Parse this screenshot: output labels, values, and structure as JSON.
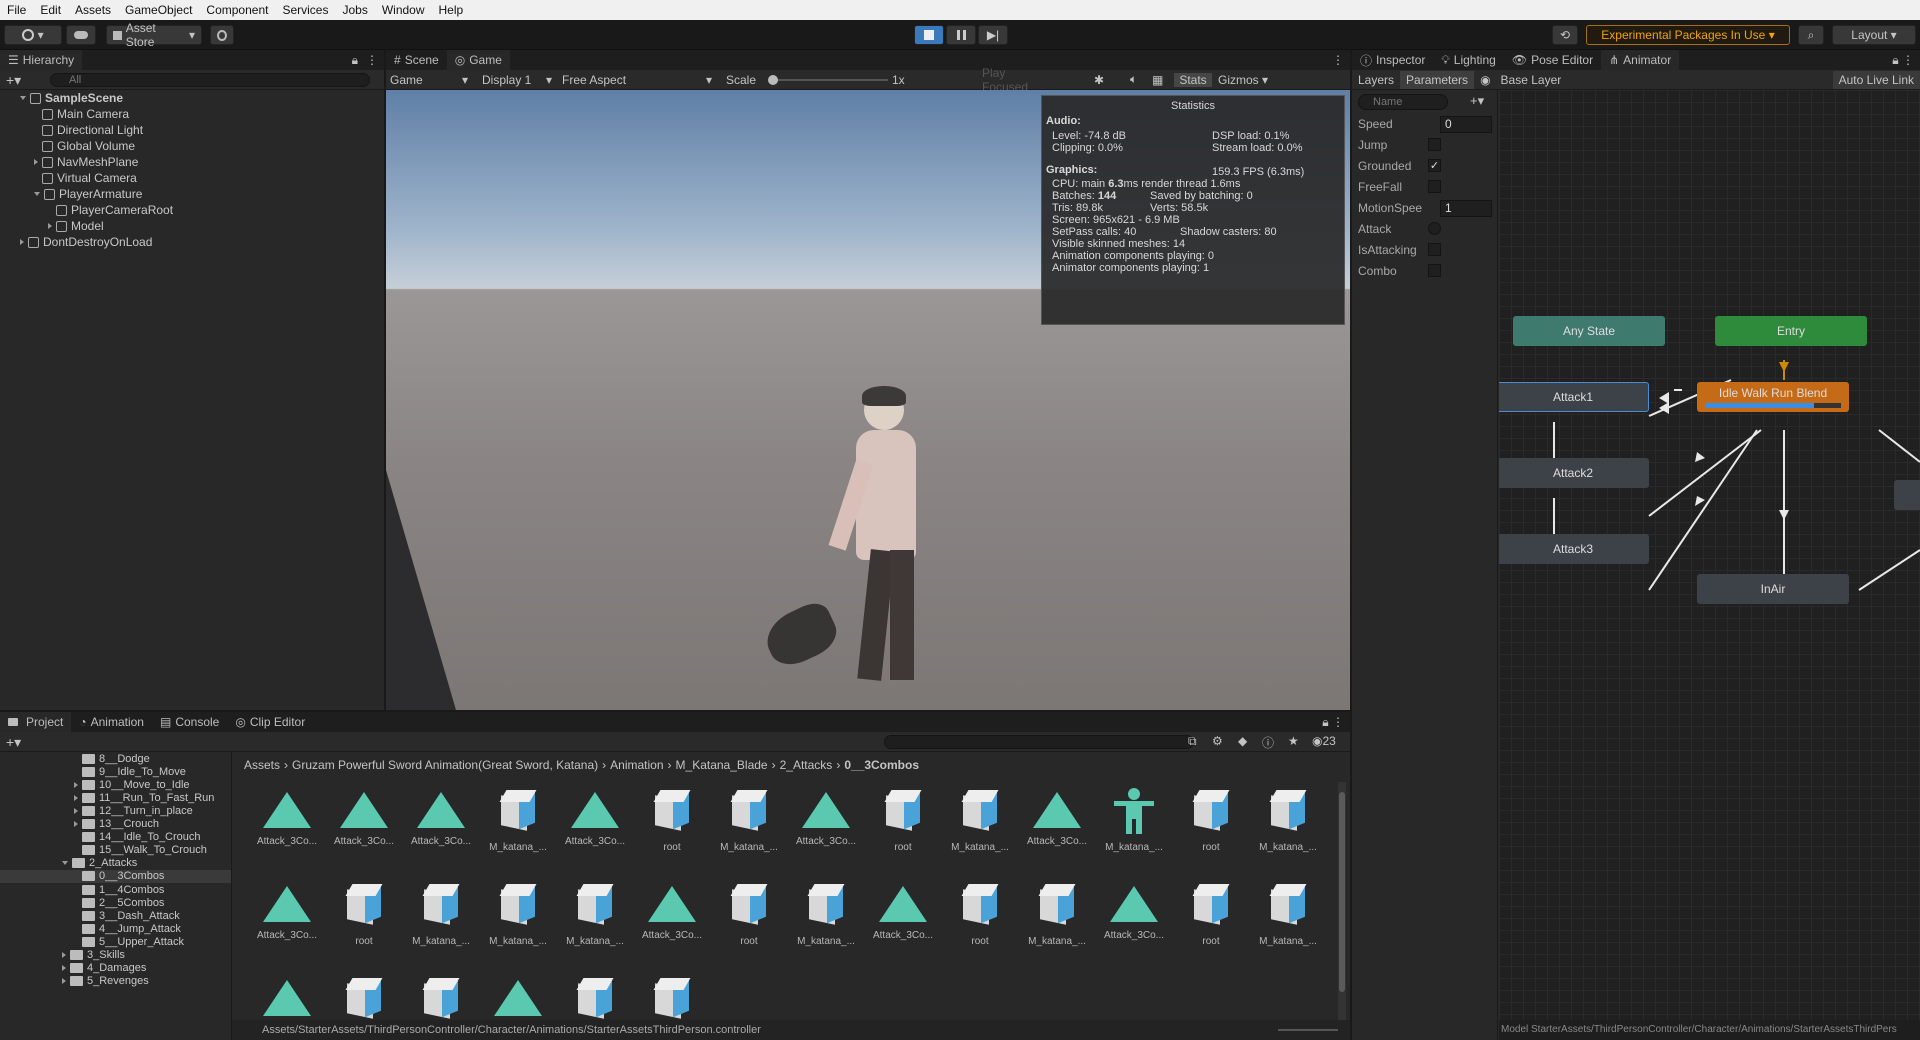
{
  "menu": [
    "File",
    "Edit",
    "Assets",
    "GameObject",
    "Component",
    "Services",
    "Jobs",
    "Window",
    "Help"
  ],
  "toolbar": {
    "account_label": "",
    "asset_store_label": "Asset Store",
    "experimental_label": "Experimental Packages In Use",
    "layout_label": "Layout"
  },
  "hierarchy": {
    "tab": "Hierarchy",
    "search_placeholder": "All",
    "rows": [
      {
        "label": "SampleScene",
        "indent": 0,
        "expand": "open",
        "bold": true
      },
      {
        "label": "Main Camera",
        "indent": 1,
        "expand": "none"
      },
      {
        "label": "Directional Light",
        "indent": 1,
        "expand": "none"
      },
      {
        "label": "Global Volume",
        "indent": 1,
        "expand": "none"
      },
      {
        "label": "NavMeshPlane",
        "indent": 1,
        "expand": "closed"
      },
      {
        "label": "Virtual Camera",
        "indent": 1,
        "expand": "none"
      },
      {
        "label": "PlayerArmature",
        "indent": 1,
        "expand": "open"
      },
      {
        "label": "PlayerCameraRoot",
        "indent": 2,
        "expand": "none"
      },
      {
        "label": "Model",
        "indent": 2,
        "expand": "closed"
      },
      {
        "label": "DontDestroyOnLoad",
        "indent": 0,
        "expand": "closed",
        "bold": false
      }
    ]
  },
  "game_view": {
    "tabs": [
      "Scene",
      "Game"
    ],
    "mode": "Game",
    "display": "Display 1",
    "aspect": "Free Aspect",
    "scale_label": "Scale",
    "scale_value": "1x",
    "play_focused": "Play Focused",
    "stats_label": "Stats",
    "gizmos_label": "Gizmos"
  },
  "statistics": {
    "title": "Statistics",
    "audio_header": "Audio:",
    "level": "Level: -74.8 dB",
    "dsp": "DSP load: 0.1%",
    "clipping": "Clipping: 0.0%",
    "stream": "Stream load: 0.0%",
    "graphics_header": "Graphics:",
    "fps": "159.3 FPS (6.3ms)",
    "cpu_prefix": "CPU: main ",
    "cpu_main": "6.3",
    "cpu_suffix": "ms  render thread 1.6ms",
    "batches_prefix": "Batches: ",
    "batches": "144",
    "saved": "Saved by batching: 0",
    "tris": "Tris: 89.8k",
    "verts": "Verts: 58.5k",
    "screen": "Screen: 965x621 - 6.9 MB",
    "setpass": "SetPass calls: 40",
    "shadow": "Shadow casters: 80",
    "skinned": "Visible skinned meshes: 14",
    "anim_playing": "Animation components playing: 0",
    "animator_playing": "Animator components playing: 1"
  },
  "right_tabs": [
    "Inspector",
    "Lighting",
    "Pose Editor",
    "Animator"
  ],
  "animator": {
    "layers_tab": "Layers",
    "parameters_tab": "Parameters",
    "base_layer": "Base Layer",
    "auto_live_link": "Auto Live Link",
    "name_placeholder": "Name",
    "params": [
      {
        "name": "Speed",
        "type": "float",
        "value": "0"
      },
      {
        "name": "Jump",
        "type": "bool",
        "value": ""
      },
      {
        "name": "Grounded",
        "type": "bool",
        "value": "✓"
      },
      {
        "name": "FreeFall",
        "type": "bool",
        "value": ""
      },
      {
        "name": "MotionSpee",
        "type": "float",
        "value": "1"
      },
      {
        "name": "Attack",
        "type": "trigger",
        "value": ""
      },
      {
        "name": "IsAttacking",
        "type": "bool",
        "value": ""
      },
      {
        "name": "Combo",
        "type": "bool",
        "value": ""
      }
    ],
    "nodes": {
      "any_state": "Any State",
      "entry": "Entry",
      "attack1": "Attack1",
      "idle_walk": "Idle Walk Run Blend",
      "attack2": "Attack2",
      "attack3": "Attack3",
      "inair": "InAir"
    },
    "status_path": "Model StarterAssets/ThirdPersonController/Character/Animations/StarterAssetsThirdPers",
    "blend_progress": 0.8
  },
  "project": {
    "tabs": [
      "Project",
      "Animation",
      "Console",
      "Clip Editor"
    ],
    "asset_count": "23",
    "breadcrumb": [
      "Assets",
      "Gruzam Powerful Sword Animation(Great Sword, Katana)",
      "Animation",
      "M_Katana_Blade",
      "2_Attacks",
      "0__3Combos"
    ],
    "tree": [
      {
        "label": "8__Dodge",
        "indent": 1,
        "expand": "none"
      },
      {
        "label": "9__Idle_To_Move",
        "indent": 1,
        "expand": "none"
      },
      {
        "label": "10__Move_to_Idle",
        "indent": 1,
        "expand": "closed"
      },
      {
        "label": "11__Run_To_Fast_Run",
        "indent": 1,
        "expand": "closed"
      },
      {
        "label": "12__Turn_in_place",
        "indent": 1,
        "expand": "closed"
      },
      {
        "label": "13__Crouch",
        "indent": 1,
        "expand": "closed"
      },
      {
        "label": "14__Idle_To_Crouch",
        "indent": 1,
        "expand": "none"
      },
      {
        "label": "15__Walk_To_Crouch",
        "indent": 1,
        "expand": "none"
      },
      {
        "label": "2_Attacks",
        "indent": 0,
        "expand": "open"
      },
      {
        "label": "0__3Combos",
        "indent": 1,
        "expand": "none",
        "selected": true
      },
      {
        "label": "1__4Combos",
        "indent": 1,
        "expand": "none"
      },
      {
        "label": "2__5Combos",
        "indent": 1,
        "expand": "none"
      },
      {
        "label": "3__Dash_Attack",
        "indent": 1,
        "expand": "none"
      },
      {
        "label": "4__Jump_Attack",
        "indent": 1,
        "expand": "none"
      },
      {
        "label": "5__Upper_Attack",
        "indent": 1,
        "expand": "none"
      },
      {
        "label": "3_Skills",
        "indent": 0,
        "expand": "closed"
      },
      {
        "label": "4_Damages",
        "indent": 0,
        "expand": "closed"
      },
      {
        "label": "5_Revenges",
        "indent": 0,
        "expand": "closed"
      }
    ],
    "assets": [
      {
        "label": "Attack_3Co...",
        "kind": "anim"
      },
      {
        "label": "Attack_3Co...",
        "kind": "anim"
      },
      {
        "label": "Attack_3Co...",
        "kind": "anim"
      },
      {
        "label": "M_katana_...",
        "kind": "box"
      },
      {
        "label": "Attack_3Co...",
        "kind": "anim"
      },
      {
        "label": "root",
        "kind": "box"
      },
      {
        "label": "M_katana_...",
        "kind": "box"
      },
      {
        "label": "Attack_3Co...",
        "kind": "anim"
      },
      {
        "label": "root",
        "kind": "box"
      },
      {
        "label": "M_katana_...",
        "kind": "box"
      },
      {
        "label": "Attack_3Co...",
        "kind": "anim"
      },
      {
        "label": "M_katana_...",
        "kind": "human"
      },
      {
        "label": "root",
        "kind": "box"
      },
      {
        "label": "M_katana_...",
        "kind": "box"
      },
      {
        "label": "Attack_3Co...",
        "kind": "anim"
      },
      {
        "label": "root",
        "kind": "box"
      },
      {
        "label": "M_katana_...",
        "kind": "box"
      },
      {
        "label": "M_katana_...",
        "kind": "box"
      },
      {
        "label": "M_katana_...",
        "kind": "box"
      },
      {
        "label": "Attack_3Co...",
        "kind": "anim"
      },
      {
        "label": "root",
        "kind": "box"
      },
      {
        "label": "M_katana_...",
        "kind": "box"
      },
      {
        "label": "Attack_3Co...",
        "kind": "anim"
      },
      {
        "label": "root",
        "kind": "box"
      },
      {
        "label": "M_katana_...",
        "kind": "box"
      },
      {
        "label": "Attack_3Co...",
        "kind": "anim"
      },
      {
        "label": "root",
        "kind": "box"
      },
      {
        "label": "M_katana_...",
        "kind": "box"
      },
      {
        "label": "",
        "kind": "anim"
      },
      {
        "label": "",
        "kind": "box"
      },
      {
        "label": "",
        "kind": "box"
      },
      {
        "label": "",
        "kind": "anim"
      },
      {
        "label": "",
        "kind": "box"
      },
      {
        "label": "",
        "kind": "box"
      }
    ],
    "status_path": "Assets/StarterAssets/ThirdPersonController/Character/Animations/StarterAssetsThirdPerson.controller"
  }
}
